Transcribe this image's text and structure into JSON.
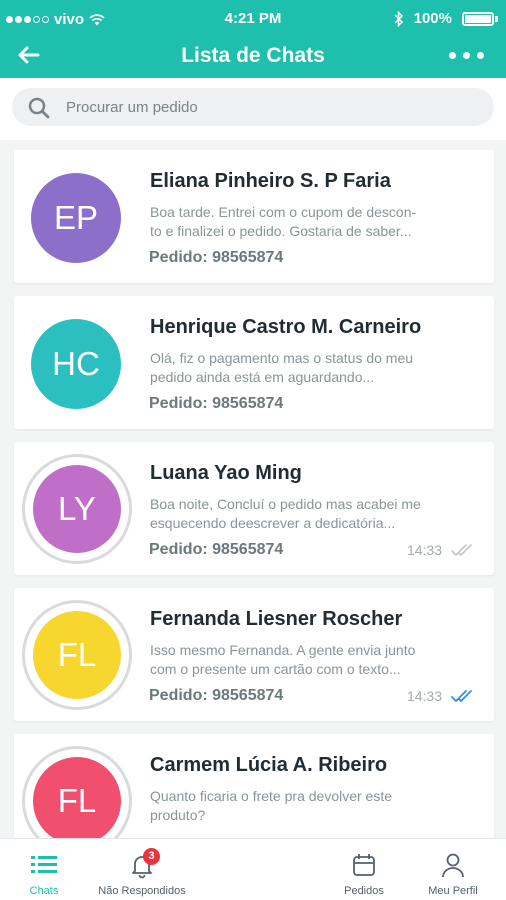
{
  "status_bar": {
    "carrier": "vivo",
    "time": "4:21 PM",
    "battery": "100%"
  },
  "header": {
    "title": "Lista de Chats"
  },
  "search": {
    "placeholder": "Procurar um pedido"
  },
  "chats": [
    {
      "initials": "EP",
      "name": "Eliana Pinheiro S. P Faria",
      "preview_line1": "Boa tarde. Entrei com o cupom de descon-",
      "preview_line2": "to e finalizei o pedido. Gostaria de saber...",
      "order": "Pedido: 98565874",
      "time": "",
      "color": "#8b6fc9"
    },
    {
      "initials": "HC",
      "name": "Henrique Castro M. Carneiro",
      "preview_line1": "Olá, fiz o pagamento mas o status do meu",
      "preview_line2": "pedido ainda está em aguardando...",
      "order": "Pedido: 98565874",
      "time": "",
      "color": "#2bbfc0"
    },
    {
      "initials": "LY",
      "name": "Luana Yao Ming",
      "preview_line1": "Boa noite, Concluí o pedido mas acabei me",
      "preview_line2": "esquecendo deescrever a dedicatória...",
      "order": "Pedido: 98565874",
      "time": "14:33",
      "color": "#c06fc9",
      "check_color": "#c2c8cb"
    },
    {
      "initials": "FL",
      "name": "Fernanda Liesner Roscher",
      "preview_line1": "Isso mesmo Fernanda. A gente envia junto",
      "preview_line2": "com o presente um cartão com o texto...",
      "order": "Pedido: 98565874",
      "time": "14:33",
      "color": "#f7d630",
      "check_color": "#2f8fe8"
    },
    {
      "initials": "FL",
      "name": "Carmem Lúcia A. Ribeiro",
      "preview_line1": "Quanto ficaria o frete pra devolver este",
      "preview_line2": "produto?",
      "order": "",
      "time": "",
      "color": "#f0506e"
    }
  ],
  "tabbar": {
    "chats": "Chats",
    "unanswered": "Não Respondidos",
    "unanswered_badge": "3",
    "orders": "Pedidos",
    "profile": "Meu Perfil"
  },
  "colors": {
    "accent": "#1fbfad",
    "badge": "#e8343d"
  },
  "icons": [
    "back-arrow-icon",
    "more-icon",
    "search-icon",
    "list-icon",
    "bell-icon",
    "calendar-icon",
    "user-icon",
    "double-check-icon"
  ]
}
